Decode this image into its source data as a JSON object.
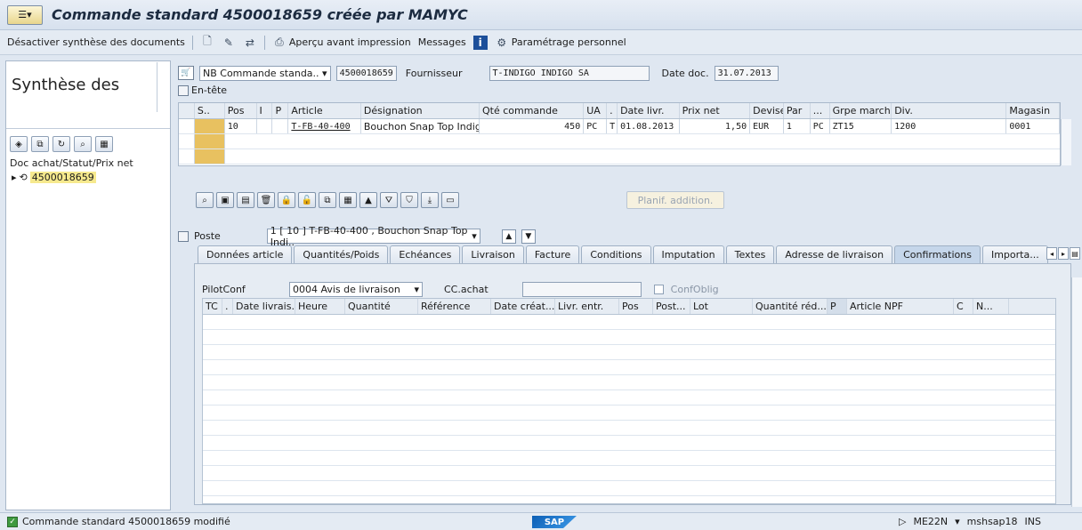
{
  "window": {
    "title": "Commande standard 4500018659 créée par MAMYC"
  },
  "toolbar": {
    "items": [
      {
        "label": "Désactiver synthèse des documents",
        "icon": ""
      },
      {
        "label": "",
        "icon": "new-doc-icon"
      },
      {
        "label": "",
        "icon": "edit-icon"
      },
      {
        "label": "",
        "icon": "other-doc-icon"
      },
      {
        "label": "Aperçu avant impression",
        "icon": "print-preview-icon"
      },
      {
        "label": "Messages",
        "icon": ""
      },
      {
        "label": "",
        "icon": "info-icon"
      },
      {
        "label": "Paramétrage personnel",
        "icon": "settings-icon"
      }
    ]
  },
  "left_pane": {
    "title": "Synthèse des",
    "column_header": "Doc achat/Statut/Prix net",
    "node": "4500018659"
  },
  "header": {
    "doc_type": "NB Commande standa..",
    "doc_number": "4500018659",
    "supplier_label": "Fournisseur",
    "supplier_value": "T-INDIGO INDIGO SA",
    "date_label": "Date doc.",
    "date_value": "31.07.2013",
    "entete_label": "En-tête"
  },
  "items_grid": {
    "columns": [
      "S..",
      "Pos",
      "I",
      "P",
      "Article",
      "Désignation",
      "Qté commande",
      "UA",
      ".",
      "Date livr.",
      "Prix net",
      "Devise",
      "Par",
      "...",
      "Grpe march.",
      "Div.",
      "Magasin"
    ],
    "rows": [
      [
        "",
        "10",
        "",
        "",
        "T-FB-40-400",
        "Bouchon Snap Top Indigo",
        "450",
        "PC",
        "T",
        "01.08.2013",
        "1,50",
        "EUR",
        "1",
        "PC",
        "ZT15",
        "1200",
        "0001"
      ]
    ]
  },
  "planif_button": "Planif. addition.",
  "poste": {
    "label": "Poste",
    "value": "1 [ 10 ] T-FB-40-400 , Bouchon Snap Top Indi.."
  },
  "tabs": [
    "Données article",
    "Quantités/Poids",
    "Echéances",
    "Livraison",
    "Facture",
    "Conditions",
    "Imputation",
    "Textes",
    "Adresse de livraison",
    "Confirmations",
    "Importa..."
  ],
  "active_tab": "Confirmations",
  "confirmations": {
    "pilotconf_label": "PilotConf",
    "pilotconf_value": "0004 Avis de livraison",
    "ccachat_label": "CC.achat",
    "ccachat_value": "",
    "confoblig_label": "ConfOblig",
    "columns": [
      "TC",
      ".",
      "Date livrais...",
      "Heure",
      "Quantité",
      "Référence",
      "Date créat...",
      "Livr. entr.",
      "Pos",
      "Post...",
      "Lot",
      "Quantité réd...",
      "P",
      "Article NPF",
      "C",
      "N..."
    ]
  },
  "status": {
    "message": "Commande standard 4500018659 modifié",
    "transaction": "ME22N",
    "server": "mshsap18",
    "mode": "INS"
  },
  "colors": {
    "accent": "#0c5fb5",
    "selected_row": "#e8c160",
    "success": "#3f9a3f"
  }
}
